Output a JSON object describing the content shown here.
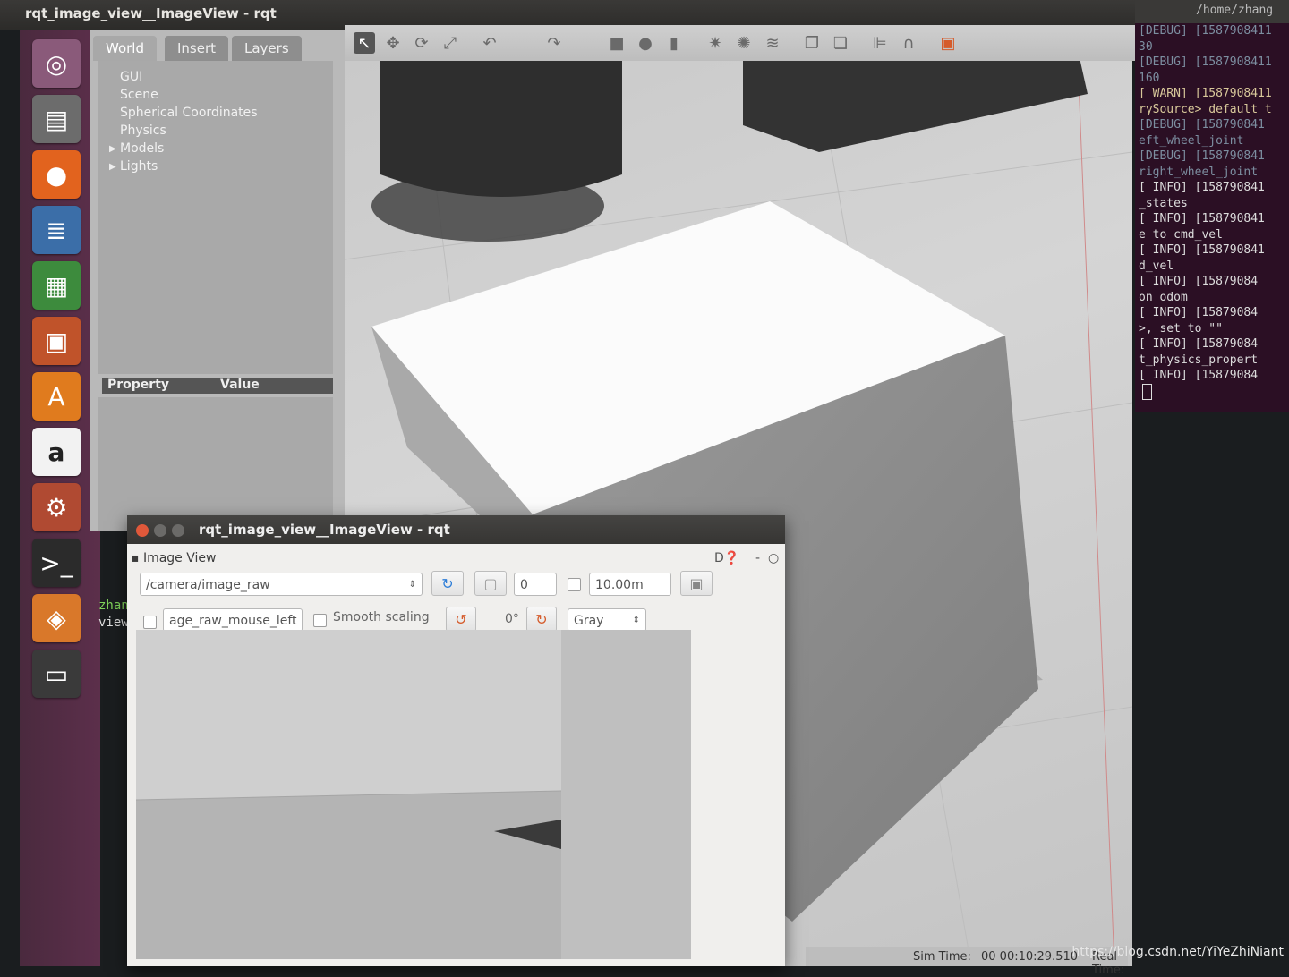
{
  "window": {
    "title": "rqt_image_view__ImageView - rqt"
  },
  "launcher": {
    "apps": [
      {
        "name": "ubuntu-dash-icon",
        "glyph": "◎",
        "color": "#8a5a7a"
      },
      {
        "name": "files-icon",
        "glyph": "▤",
        "color": "#6c6c6c"
      },
      {
        "name": "firefox-icon",
        "glyph": "●",
        "color": "#e2631e"
      },
      {
        "name": "writer-icon",
        "glyph": "≣",
        "color": "#3b6ea8"
      },
      {
        "name": "calc-icon",
        "glyph": "▦",
        "color": "#3d8b3d"
      },
      {
        "name": "impress-icon",
        "glyph": "▣",
        "color": "#c0532a"
      },
      {
        "name": "software-center-icon",
        "glyph": "A",
        "color": "#e07b1e"
      },
      {
        "name": "amazon-icon",
        "glyph": "a",
        "color": "#f2f2f2"
      },
      {
        "name": "settings-icon",
        "glyph": "⚙",
        "color": "#b04a32"
      },
      {
        "name": "terminal-icon",
        "glyph": ">_",
        "color": "#2b2b2b"
      },
      {
        "name": "gazebo-icon",
        "glyph": "◈",
        "color": "#d9782a"
      },
      {
        "name": "workspace-icon",
        "glyph": "▭",
        "color": "#3a3a3a"
      }
    ]
  },
  "gazebo": {
    "tabs": [
      "World",
      "Insert",
      "Layers"
    ],
    "tree": [
      "GUI",
      "Scene",
      "Spherical Coordinates",
      "Physics",
      "Models",
      "Lights"
    ],
    "expandable": [
      "Models",
      "Lights"
    ],
    "property_header": "Property",
    "value_header": "Value",
    "status": {
      "sim_time_label": "Sim Time:",
      "sim_time": "00 00:10:29.510",
      "real_time_label": "Real Time:"
    }
  },
  "terminal": {
    "path": "/home/zhang",
    "lines": [
      {
        "t": "[DEBUG] [1587908411",
        "k": "dbg"
      },
      {
        "t": "30",
        "k": "dbg"
      },
      {
        "t": "[DEBUG] [1587908411",
        "k": "dbg"
      },
      {
        "t": "160",
        "k": "dbg"
      },
      {
        "t": "[ WARN] [1587908411",
        "k": "warn"
      },
      {
        "t": "rySource> default t",
        "k": "warn"
      },
      {
        "t": "[DEBUG] [158790841",
        "k": "dbg"
      },
      {
        "t": "eft_wheel_joint",
        "k": "dbg"
      },
      {
        "t": "[DEBUG] [158790841",
        "k": "dbg"
      },
      {
        "t": "right_wheel_joint",
        "k": "dbg"
      },
      {
        "t": "[ INFO] [158790841",
        "k": "info"
      },
      {
        "t": "_states",
        "k": "info"
      },
      {
        "t": "[ INFO] [158790841",
        "k": "info"
      },
      {
        "t": "e to cmd_vel",
        "k": "info"
      },
      {
        "t": "[ INFO] [158790841",
        "k": "info"
      },
      {
        "t": "d_vel",
        "k": "info"
      },
      {
        "t": "[ INFO] [15879084",
        "k": "info"
      },
      {
        "t": "on odom",
        "k": "info"
      },
      {
        "t": "[ INFO] [15879084",
        "k": "info"
      },
      {
        "t": ">, set to \"\"",
        "k": "info"
      },
      {
        "t": "[ INFO] [15879084",
        "k": "info"
      },
      {
        "t": "t_physics_propert",
        "k": "info"
      },
      {
        "t": "[ INFO] [15879084",
        "k": "info"
      }
    ],
    "left_lines": [
      "zhan",
      "view"
    ]
  },
  "rqt": {
    "panel_title": "Image View",
    "help_label": "D",
    "topic": "/camera/image_raw",
    "spin_value": "0",
    "max_range": "10.00m",
    "mouse_topic": "age_raw_mouse_left",
    "smooth_label": "Smooth scaling",
    "rotation": "0°",
    "colormap": "Gray"
  },
  "watermark": "https://blog.csdn.net/YiYeZhiNiant"
}
